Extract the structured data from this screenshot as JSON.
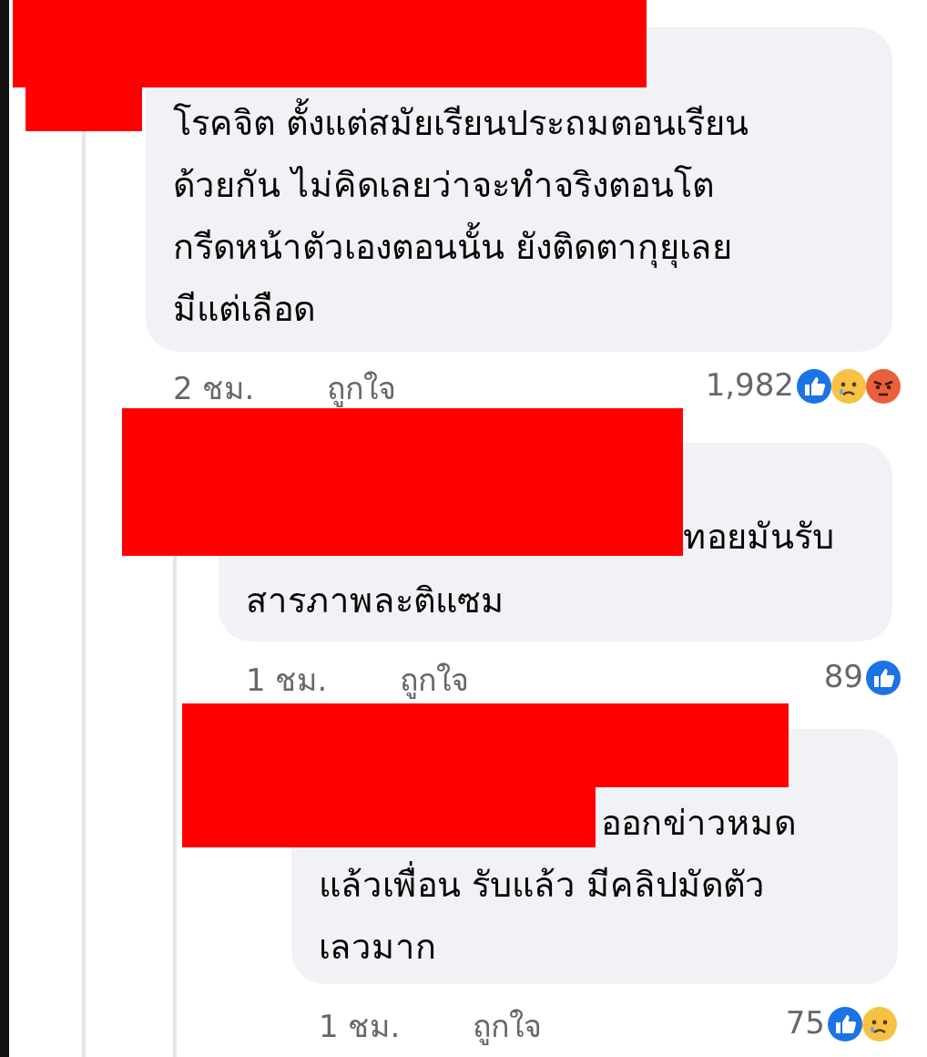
{
  "comments": [
    {
      "redacted": true,
      "text": "โรคจิต ตั้งแต่สมัยเรียนประถมตอนเรียน\nด้วยกัน ไม่คิดเลยว่าจะทำจริงตอนโต\nกรีดหน้าตัวเองตอนนั้น ยังติดตากุยุเลย\nมีแต่เลือด",
      "time": "2 ชม.",
      "like_label": "ถูกใจ",
      "reaction_count": "1,982",
      "reactions": [
        {
          "kind": "like"
        },
        {
          "kind": "sad"
        },
        {
          "kind": "angry"
        }
      ],
      "children": [
        {
          "redacted": true,
          "text_fragment": "ทอยมันรับ",
          "text": "สารภาพละติแซม",
          "time": "1 ชม.",
          "like_label": "ถูกใจ",
          "reaction_count": "89",
          "reactions": [
            {
              "kind": "like"
            }
          ],
          "children": [
            {
              "redacted": true,
              "text_fragment": "ออกข่าวหมด",
              "text": "แล้วเพื่อน รับแล้ว มีคลิปมัดตัว\nเลวมาก",
              "time": "1 ชม.",
              "like_label": "ถูกใจ",
              "reaction_count": "75",
              "reactions": [
                {
                  "kind": "like"
                },
                {
                  "kind": "sad"
                }
              ]
            }
          ]
        }
      ]
    }
  ]
}
